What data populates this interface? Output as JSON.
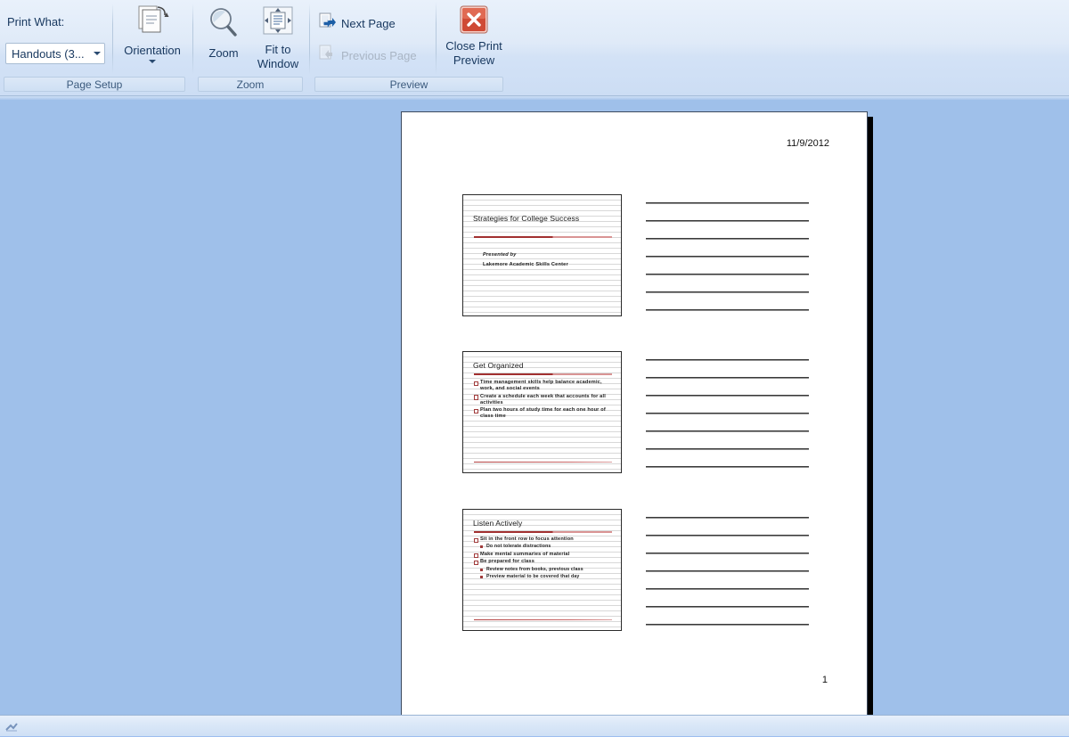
{
  "ribbon": {
    "groups": [
      {
        "name": "Page Setup",
        "label": "Page Setup"
      },
      {
        "name": "Zoom",
        "label": "Zoom"
      },
      {
        "name": "Preview",
        "label": "Preview"
      }
    ],
    "page_setup": {
      "print_what_label": "Print What:",
      "print_what_value": "Handouts (3...",
      "orientation_label": "Orientation"
    },
    "zoom": {
      "zoom_label": "Zoom",
      "fit_to_window_label": "Fit to\nWindow",
      "fit_to_window_line1": "Fit to",
      "fit_to_window_line2": "Window"
    },
    "preview": {
      "next_page_label": "Next Page",
      "previous_page_label": "Previous Page",
      "previous_page_disabled": true,
      "close_print_preview_line1": "Close Print",
      "close_print_preview_line2": "Preview"
    }
  },
  "document": {
    "header_date": "11/9/2012",
    "footer_page_number": "1",
    "accent_color": "#a23030",
    "slides": [
      {
        "title": "Strategies for College Success",
        "subtitle_italic": "Presented by",
        "subtitle": "Lakemore Academic Skills Center",
        "bullets": []
      },
      {
        "title": "Get Organized",
        "bullets": [
          {
            "level": 1,
            "text": "Time management skills help balance academic, work, and social events"
          },
          {
            "level": 1,
            "text": "Create a schedule each week that accounts for all activities"
          },
          {
            "level": 1,
            "text": "Plan two hours of study time for each one hour of class time"
          }
        ]
      },
      {
        "title": "Listen Actively",
        "bullets": [
          {
            "level": 1,
            "text": "Sit in the front row to focus attention"
          },
          {
            "level": 2,
            "text": "Do not tolerate distractions"
          },
          {
            "level": 1,
            "text": "Make mental summaries of material"
          },
          {
            "level": 1,
            "text": "Be prepared for class"
          },
          {
            "level": 2,
            "text": "Review notes from books, previous class"
          },
          {
            "level": 2,
            "text": "Preview material to be covered that day"
          }
        ]
      }
    ],
    "note_lines_per_slide": 7
  }
}
